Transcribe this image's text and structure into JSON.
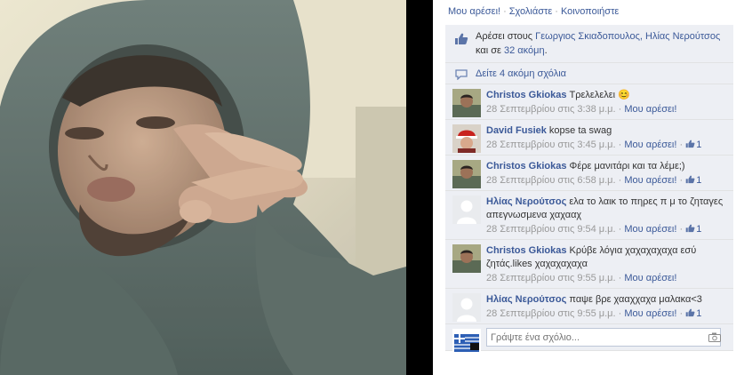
{
  "actions": {
    "like": "Μου αρέσει!",
    "comment": "Σχολιάστε",
    "share": "Κοινοποιήστε",
    "separator": "·"
  },
  "likes": {
    "prefix": "Αρέσει στους",
    "names": "Γεωργιος Σκιαδοπουλος, Ηλίας Νερούτσος",
    "and": "και σε",
    "others": "32 ακόμη",
    "suffix": "."
  },
  "more_comments": "Δείτε 4 ακόμη σχόλια",
  "comments": [
    {
      "name": "Christos Gkiokas",
      "text": "Τρελελελει 😊",
      "time": "28 Σεπτεμβρίου στις 3:38 μ.μ.",
      "like_label": "Μου αρέσει!",
      "likes": ""
    },
    {
      "name": "David Fusiek",
      "text": "kopse ta swag",
      "time": "28 Σεπτεμβρίου στις 3:45 μ.μ.",
      "like_label": "Μου αρέσει!",
      "likes": "1"
    },
    {
      "name": "Christos Gkiokas",
      "text": "Φέρε μανιτάρι και τα λέμε;)",
      "time": "28 Σεπτεμβρίου στις 6:58 μ.μ.",
      "like_label": "Μου αρέσει!",
      "likes": "1"
    },
    {
      "name": "Ηλίας Νερούτσος",
      "text": "ελα το λαικ το πηρες π μ το ζηταγες απεγνωσμενα χαχααχ",
      "time": "28 Σεπτεμβρίου στις 9:54 μ.μ.",
      "like_label": "Μου αρέσει!",
      "likes": "1"
    },
    {
      "name": "Christos Gkiokas",
      "text": "Κρύβε λόγια χαχαχαχαχα εσύ ζητάς.likes χαχαχαχαχα",
      "time": "28 Σεπτεμβρίου στις 9:55 μ.μ.",
      "like_label": "Μου αρέσει!",
      "likes": ""
    },
    {
      "name": "Ηλίας Νερούτσος",
      "text": "παψε βρε χααχχαχα μαλακα<3",
      "time": "28 Σεπτεμβρίου στις 9:55 μ.μ.",
      "like_label": "Μου αρέσει!",
      "likes": "1"
    }
  ],
  "write_comment": {
    "placeholder": "Γράψτε ένα σχόλιο..."
  },
  "icons": {
    "like": "thumbs-up-icon",
    "comments": "speech-bubble-icon",
    "camera": "camera-icon"
  },
  "colors": {
    "link": "#3b5998",
    "ufi_bg": "#edeff4",
    "muted": "#999999"
  }
}
